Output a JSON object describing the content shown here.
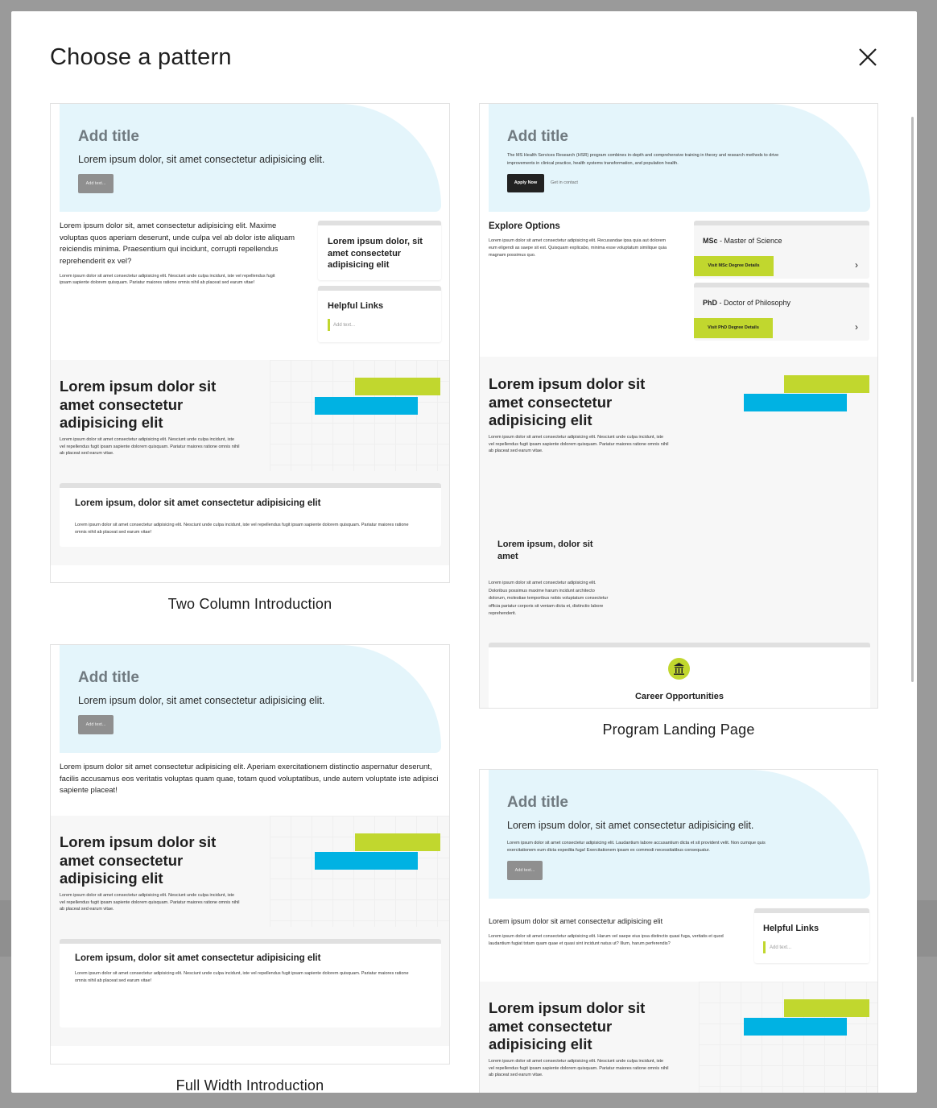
{
  "modal": {
    "title": "Choose a pattern",
    "close_label": "Close"
  },
  "patterns": {
    "two_column": {
      "caption": "Two Column Introduction",
      "hero_title": "Add title",
      "hero_subtitle": "Lorem ipsum dolor, sit amet consectetur adipisicing elit.",
      "hero_button": "Add text...",
      "left_paragraph": "Lorem ipsum dolor sit, amet consectetur adipisicing elit. Maxime voluptas quos aperiam deserunt, unde culpa vel ab dolor iste aliquam reiciendis minima. Praesentium qui incidunt, corrupti repellendus reprehenderit ex vel?",
      "left_small": "Lorem ipsum dolor sit amet consectetur adipisicing elit. Nesciunt unde culpa incidunt, iste vel repellendus fugit ipsam sapiente dolorem quisquam. Pariatur maiores ratione omnis nihil ab placeat sed earum vitae!",
      "side_box_title": "Lorem ipsum dolor, sit amet consectetur adipisicing elit",
      "links_title": "Helpful Links",
      "links_placeholder": "Add text...",
      "band_heading": "Lorem ipsum dolor sit amet consectetur adipisicing elit",
      "band_text": "Lorem ipsum dolor sit amet consectetur adipisicing elit. Nesciunt unde culpa incidunt, iste vel repellendus fugit ipsam sapiente dolorem quisquam. Pariatur maiores ratione omnis nihil ab placeat sed earum vitae.",
      "box_title": "Lorem ipsum, dolor sit amet consectetur adipisicing elit",
      "box_text": "Lorem ipsum dolor sit amet consectetur adipisicing elit. Nesciunt unde culpa incidunt, iste vel repellendus fugit ipsam sapiente dolorem quisquam. Pariatur maiores ratione omnis nihil ab placeat sed earum vitae!"
    },
    "program": {
      "caption": "Program Landing Page",
      "hero_title": "Add title",
      "hero_text": "The MS Health Services Research (HSR) program combines in-depth and comprehensive training in theory and research methods to drive improvements in clinical practice, health systems transformation, and population health.",
      "apply_button": "Apply Now",
      "contact_link": "Get in contact",
      "explore_title": "Explore Options",
      "explore_text": "Lorem ipsum dolor sit amet consectetur adipisicing elit. Recusandae ipsa quia aut dolorem eum eligendi as saepe sit est. Quisquam explicabo, minima esse voluptatum similique quia magnam possimus quo.",
      "msc_abbr": "MSc",
      "msc_label": "- Master of Science",
      "msc_button": "Visit MSc Degree Details",
      "phd_abbr": "PhD",
      "phd_label": "- Doctor of Philosophy",
      "phd_button": "Visit PhD Degree Details",
      "band_heading": "Lorem ipsum dolor sit amet consectetur adipisicing elit",
      "band_text": "Lorem ipsum dolor sit amet consectetur adipisicing elit. Nesciunt unde culpa incidunt, iste vel repellendus fugit ipsam sapiente dolorem quisquam. Pariatur maiores ratione omnis nihil ab placeat sed earum vitae.",
      "sub_heading": "Lorem ipsum, dolor sit amet",
      "sub_text": "Lorem ipsum dolor sit amet consectetur adipisicing elit. Doloribus possimus maxime harum incidunt architecto dolorum, molestiae temporibus nobis voluptatum consectetur officia pariatur corporis sit veniam dicta et, distinctio labore reprehenderit.",
      "career_title": "Career Opportunities"
    },
    "full_width": {
      "caption": "Full Width Introduction",
      "hero_title": "Add title",
      "hero_subtitle": "Lorem ipsum dolor, sit amet consectetur adipisicing elit.",
      "hero_button": "Add text...",
      "paragraph": "Lorem ipsum dolor sit amet consectetur adipisicing elit. Aperiam exercitationem distinctio aspernatur deserunt, facilis accusamus eos veritatis voluptas quam quae, totam quod voluptatibus, unde autem voluptate iste adipisci sapiente placeat!",
      "band_heading": "Lorem ipsum dolor sit amet consectetur adipisicing elit",
      "band_text": "Lorem ipsum dolor sit amet consectetur adipisicing elit. Nesciunt unde culpa incidunt, iste vel repellendus fugit ipsam sapiente dolorem quisquam. Pariatur maiores ratione omnis nihil ab placeat sed earum vitae.",
      "box_title": "Lorem ipsum, dolor sit amet consectetur adipisicing elit",
      "box_text": "Lorem ipsum dolor sit amet consectetur adipisicing elit. Nesciunt unde culpa incidunt, iste vel repellendus fugit ipsam sapiente dolorem quisquam. Pariatur maiores ratione omnis nihil ab placeat sed earum vitae!"
    },
    "fourth": {
      "hero_title": "Add title",
      "hero_subtitle": "Lorem ipsum dolor, sit amet consectetur adipisicing elit.",
      "hero_text": "Lorem ipsum dolor sit amet consectetur adipisicing elit. Laudantium labore accusantium dicta et sit provident velit. Non cumque quis exercitationem eum dicta expedita fuga! Exercitationem ipsam ex commodi necessitatibus consequatur.",
      "hero_button": "Add text...",
      "paragraph": "Lorem ipsum dolor sit amet consectetur adipisicing elit",
      "small_text": "Lorem ipsum dolor sit amet consectetur adipisicing elit. Harum vel saepe eius ipsa distinctio quasi fuga, veritatis et quod laudantium fugiat totam quam quae et quasi sint incidunt natus ut? Illum, harum perferendis?",
      "links_title": "Helpful Links",
      "links_placeholder": "Add text...",
      "band_heading": "Lorem ipsum dolor sit amet consectetur adipisicing elit",
      "band_text": "Lorem ipsum dolor sit amet consectetur adipisicing elit. Nesciunt unde culpa incidunt, iste vel repellendus fugit ipsam sapiente dolorem quisquam. Pariatur maiores ratione omnis nihil ab placeat sed earum vitae."
    }
  },
  "colors": {
    "hero_bg": "#e4f5fb",
    "lime": "#c1d72e",
    "cyan": "#00b2e3",
    "overlay": "#9a9a9a"
  }
}
